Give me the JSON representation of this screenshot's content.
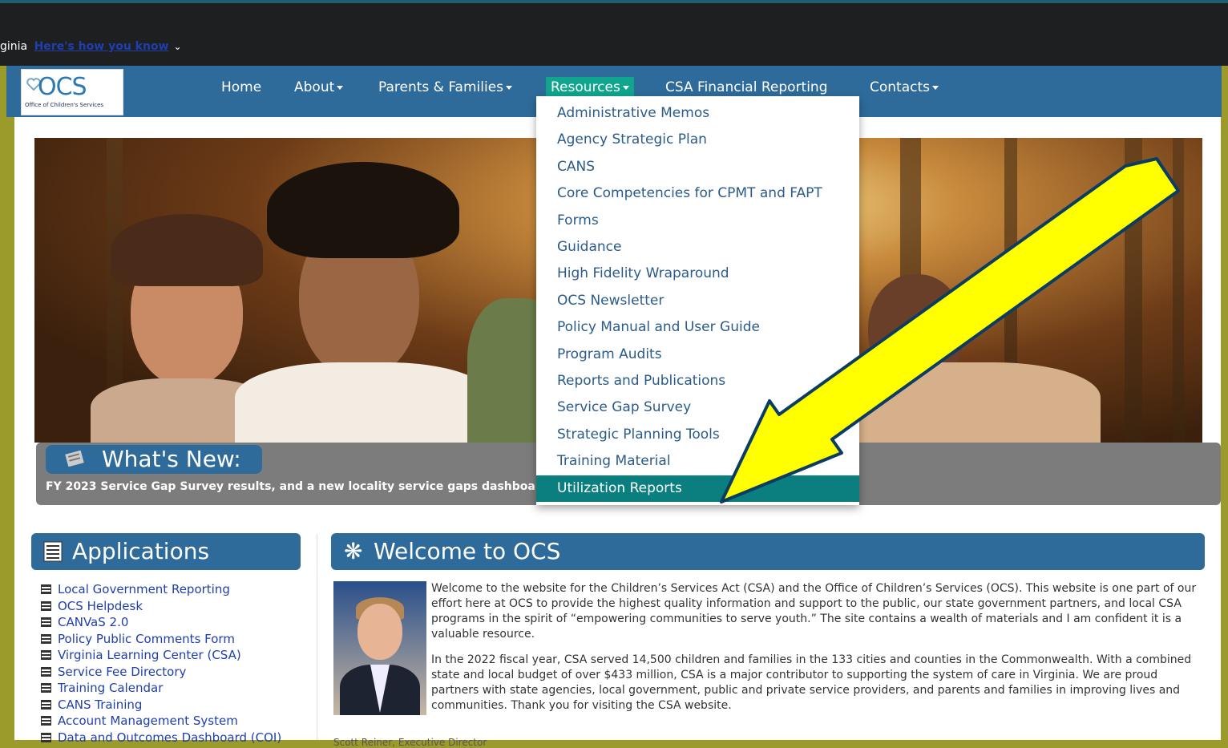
{
  "gov_banner": {
    "prefix": "ginia",
    "link": "Here's how you know"
  },
  "logo": {
    "text": "OCS",
    "subtitle": "Office of Children's Services"
  },
  "nav": {
    "home": "Home",
    "about": "About",
    "parents": "Parents & Families",
    "resources": "Resources",
    "csa_financial": "CSA Financial Reporting",
    "contacts": "Contacts"
  },
  "resources_menu": [
    "Administrative Memos",
    "Agency Strategic Plan",
    "CANS",
    "Core Competencies for CPMT and FAPT",
    "Forms",
    "Guidance",
    "High Fidelity Wraparound",
    "OCS Newsletter",
    "Policy Manual and User Guide",
    "Program Audits",
    "Reports and Publications",
    "Service Gap Survey",
    "Strategic Planning Tools",
    "Training Material",
    "Utilization Reports"
  ],
  "whats_new": {
    "title": "What's New:",
    "text": "FY 2023 Service Gap Survey results, and a new locality service gaps dashboard"
  },
  "applications": {
    "title": "Applications",
    "items": [
      "Local Government Reporting",
      "OCS Helpdesk",
      "CANVaS 2.0",
      "Policy Public Comments Form",
      "Virginia Learning Center (CSA)",
      "Service Fee Directory",
      "Training Calendar",
      "CANS Training",
      "Account Management System",
      "Data and Outcomes Dashboard (COI)"
    ]
  },
  "welcome": {
    "title": "Welcome to OCS",
    "p1": "Welcome to the website for the Children’s Services Act (CSA) and the Office of Children’s Services (OCS). This website is one part of our effort here at OCS to provide the highest quality information and support to the public, our state government partners, and local CSA programs in the spirit of “empowering communities to serve youth.” The site contains a wealth of materials and I am confident it is a valuable resource.",
    "p2": "In the 2022 fiscal year, CSA served 14,500 children and families in the 133 cities and counties in the Commonwealth. With a combined state and local budget of over $433 million, CSA is a major contributor to supporting the system of care in Virginia. We are proud partners with state agencies, local government, public and private service providers, and parents and families in improving lives and communities. Thank you for visiting the CSA website.",
    "signature": "Scott Reiner, Executive Director"
  },
  "colors": {
    "nav_blue": "#2e6b9a",
    "active_teal": "#10a58d",
    "highlight": "#0b7f80",
    "arrow_yellow": "#ffff00"
  },
  "icons": [
    "chevron-down-icon",
    "caret-down-icon",
    "newspaper-icon",
    "list-icon",
    "asterisk-icon",
    "arrow-annotation-icon"
  ]
}
